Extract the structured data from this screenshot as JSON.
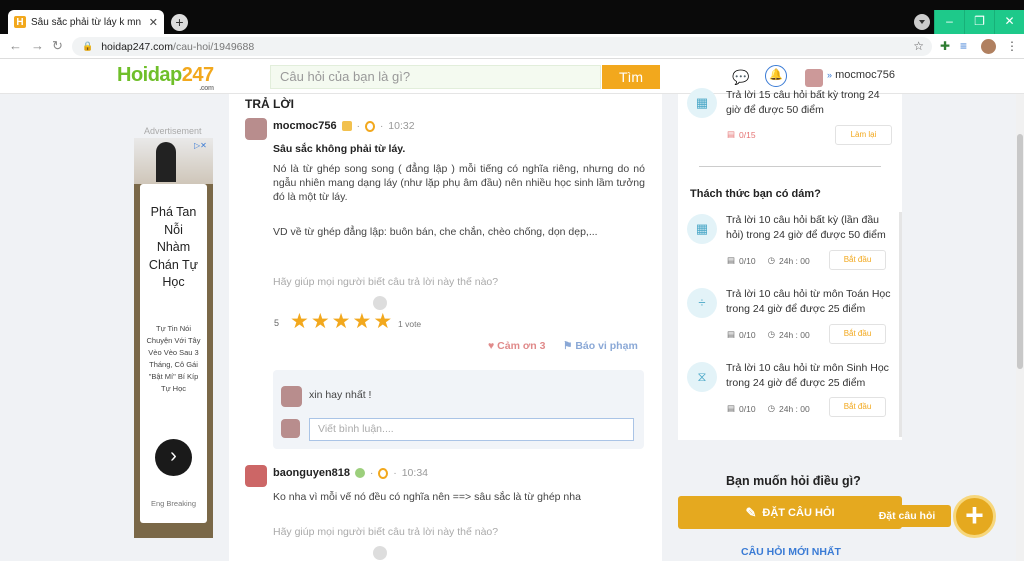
{
  "browser": {
    "tab_title": "Sâu sắc phải từ láy k mn câu hỏi",
    "tab_favicon": "H",
    "url_host": "hoidap247.com",
    "url_path": "/cau-hoi/1949688"
  },
  "site": {
    "logo_main": "Hoidap",
    "logo_num": "247",
    "logo_sub": ".com",
    "search_placeholder": "Câu hỏi của bạn là gì?",
    "search_button": "Tìm",
    "username": "mocmoc756"
  },
  "ad": {
    "label": "Advertisement",
    "headline": "Phá Tan Nỗi Nhàm Chán Tự Học",
    "body": "Tự Tin Nói Chuyện Với Tây Vèo Vèo Sau 3 Tháng, Cô Gái \"Bật Mí\" Bí Kíp Tự Học",
    "brand": "Eng Breaking"
  },
  "answers_section": {
    "title": "TRẢ LỜI",
    "answers": [
      {
        "user": "mocmoc756",
        "time": "10:32",
        "bold": "Sâu sắc không phải từ láy.",
        "p1": "Nó là từ ghép song song ( đẳng lập ) mỗi tiếng có nghĩa riêng, nhưng do nó ngẫu nhiên mang dạng láy (như lặp phụ âm đầu) nên nhiều học sinh lầm tưởng đó là một từ láy.",
        "p2": "VD về từ ghép đẳng lập: buôn bán, che chắn, chèo chống, dọn dẹp,...",
        "help": "Hãy giúp mọi người biết câu trả lời này thế nào?",
        "rating": "5",
        "votes": "1 vote",
        "thanks": "Cảm ơn 3",
        "report": "Báo vi phạm",
        "comment": "xin hay nhất !",
        "comment_placeholder": "Viết bình luận...."
      },
      {
        "user": "baonguyen818",
        "time": "10:34",
        "p1": "Ko nha vì mỗi vế nó đều có nghĩa nên ==> sâu sắc là từ ghép nha",
        "help": "Hãy giúp mọi người biết câu trả lời này thế nào?"
      }
    ]
  },
  "sidebar": {
    "top_challenge": {
      "text": "Trả lời 15 câu hỏi  bất kỳ  trong 24 giờ để được 50 điểm",
      "progress": "0/15",
      "button": "Làm lại"
    },
    "challenge_title": "Thách thức bạn có dám?",
    "challenges": [
      {
        "icon": "grid-icon",
        "text": "Trả lời 10 câu hỏi  bất kỳ (lần đầu hỏi) trong 24 giờ để được 50 điểm",
        "progress": "0/10",
        "time": "24h : 00",
        "button": "Bắt đầu"
      },
      {
        "icon": "math-icon",
        "text": "Trả lời 10 câu hỏi  từ môn Toán Học trong 24 giờ để được 25 điểm",
        "progress": "0/10",
        "time": "24h : 00",
        "button": "Bắt đầu"
      },
      {
        "icon": "dna-icon",
        "text": "Trả lời 10 câu hỏi  từ môn Sinh Học trong 24 giờ để được 25 điểm",
        "progress": "0/10",
        "time": "24h : 00",
        "button": "Bắt đầu"
      }
    ],
    "ask_title": "Bạn muốn hỏi điều gì?",
    "ask_button": "ĐẶT CÂU HỎI",
    "newest": "CÂU HỎI MỚI NHẤT",
    "fab_label": "Đặt câu hỏi"
  },
  "colors": {
    "accent": "#f2a81d",
    "green": "#6fbf2a",
    "blue": "#3a7bd5"
  }
}
